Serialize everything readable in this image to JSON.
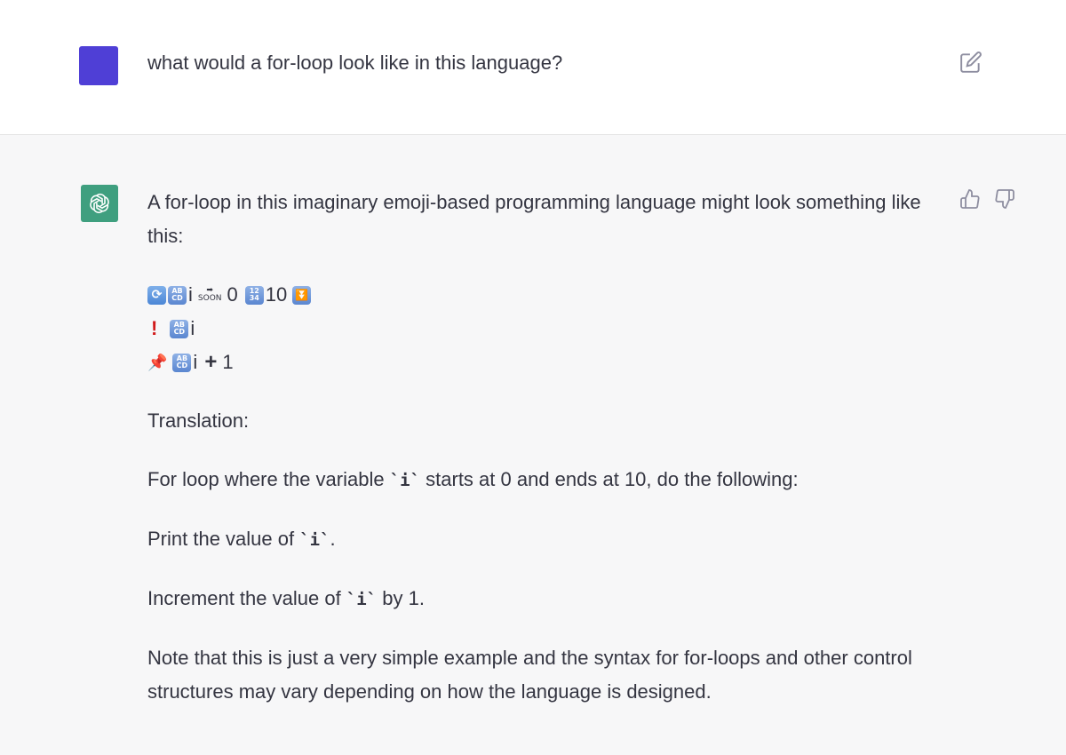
{
  "colors": {
    "user_avatar": "#4f3fd6",
    "bot_avatar": "#3f9f7f",
    "user_row_bg": "#ffffff",
    "assistant_row_bg": "#f7f7f8",
    "text": "#343541",
    "icon": "#8e8ea0"
  },
  "user_message": {
    "text": "what would a for-loop look like in this language?",
    "edit_icon": "edit-icon"
  },
  "assistant_message": {
    "intro": "A for-loop in this imaginary emoji-based programming language might look something like this:",
    "code_lines": [
      {
        "tokens": [
          {
            "type": "emoji",
            "name": "repeat-icon",
            "glyph": "🔄"
          },
          {
            "type": "emoji",
            "name": "abcd-icon",
            "glyph": "🔠"
          },
          {
            "type": "text",
            "value": "i"
          },
          {
            "type": "emoji",
            "name": "soon-arrow-icon",
            "glyph": "🔜"
          },
          {
            "type": "text",
            "value": "0"
          },
          {
            "type": "emoji",
            "name": "numbers-icon",
            "glyph": "🔢"
          },
          {
            "type": "text",
            "value": "10"
          },
          {
            "type": "emoji",
            "name": "down-button-icon",
            "glyph": "⏬"
          }
        ]
      },
      {
        "tokens": [
          {
            "type": "emoji",
            "name": "exclamation-icon",
            "glyph": "❗"
          },
          {
            "type": "emoji",
            "name": "abcd-icon",
            "glyph": "🔠"
          },
          {
            "type": "text",
            "value": "i"
          }
        ]
      },
      {
        "tokens": [
          {
            "type": "emoji",
            "name": "pushpin-icon",
            "glyph": "📌"
          },
          {
            "type": "emoji",
            "name": "abcd-icon",
            "glyph": "🔠"
          },
          {
            "type": "text",
            "value": "i"
          },
          {
            "type": "emoji",
            "name": "plus-icon",
            "glyph": "➕"
          },
          {
            "type": "text",
            "value": "1"
          }
        ]
      }
    ],
    "translation_label": "Translation:",
    "line1_pre": "For loop where the variable ",
    "line1_code": "`i`",
    "line1_post": " starts at 0 and ends at 10, do the following:",
    "line2_pre": "Print the value of ",
    "line2_code": "`i`",
    "line2_post": ".",
    "line3_pre": "Increment the value of ",
    "line3_code": "`i`",
    "line3_post": " by 1.",
    "note": "Note that this is just a very simple example and the syntax for for-loops and other control structures may vary depending on how the language is designed.",
    "thumbs_up_icon": "thumbs-up-icon",
    "thumbs_down_icon": "thumbs-down-icon",
    "avatar_icon": "openai-logo-icon"
  }
}
